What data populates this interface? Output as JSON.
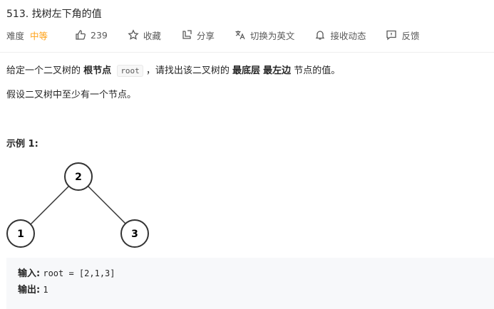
{
  "problem": {
    "title": "513. 找树左下角的值"
  },
  "meta": {
    "difficulty_label": "难度",
    "difficulty_value": "中等",
    "difficulty_color": "#ffa116",
    "likes": "239",
    "favorite_label": "收藏",
    "share_label": "分享",
    "switch_lang_label": "切换为英文",
    "notify_label": "接收动态",
    "feedback_label": "反馈",
    "icons": [
      "thumbs-up-icon",
      "star-icon",
      "share-icon",
      "translate-icon",
      "bell-icon",
      "feedback-icon"
    ]
  },
  "description": {
    "p1_part1": "给定一个二叉树的",
    "p1_bold1": "根节点",
    "p1_code": "root",
    "p1_part2": "，请找出该二叉树的",
    "p1_bold2": "最底层",
    "p1_bold3": "最左边",
    "p1_part3": "节点的值。",
    "p2": "假设二叉树中至少有一个节点。"
  },
  "example": {
    "title": "示例 1:",
    "tree_nodes": [
      "2",
      "1",
      "3"
    ],
    "input_label": "输入",
    "input_value": "root = [2,1,3]",
    "output_label": "输出",
    "output_value": "1"
  }
}
